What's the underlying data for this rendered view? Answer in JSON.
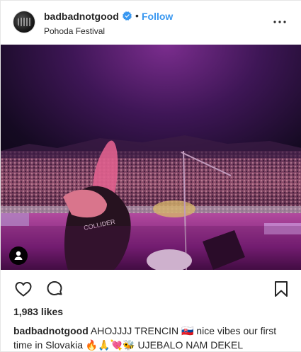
{
  "post": {
    "username": "badbadnotgood",
    "verified": true,
    "separator": "•",
    "follow_label": "Follow",
    "location": "Pohoda Festival",
    "more_icon": "ellipsis-icon"
  },
  "image": {
    "description_icon": "tagged-people-icon"
  },
  "actions": {
    "like_icon": "heart-icon",
    "comment_icon": "comment-icon",
    "save_icon": "bookmark-icon"
  },
  "likes": {
    "text": "1,983 likes"
  },
  "caption": {
    "username": "badbadnotgood",
    "line1": "AHOJJJJ TRENCIN 🇸🇰 nice vibes our first",
    "line2": "time in Slovakia 🔥🙏💘🐝 UJEBALO NAM DEKEL"
  },
  "colors": {
    "link": "#3897f0",
    "text": "#262626",
    "verified": "#3897f0"
  }
}
